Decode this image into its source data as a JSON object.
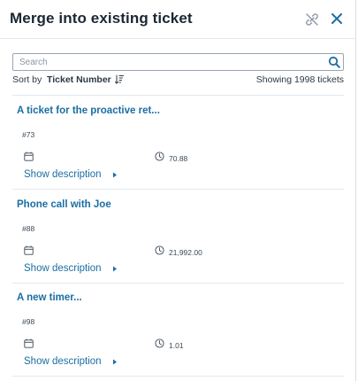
{
  "header": {
    "title": "Merge into existing ticket",
    "unmerge_icon": "link-off-icon",
    "close_icon": "close-icon"
  },
  "search": {
    "placeholder": "Search",
    "value": "",
    "icon": "search-icon"
  },
  "sort": {
    "label": "Sort by",
    "field": "Ticket Number",
    "direction_icon": "sort-descending-icon",
    "count_text": "Showing 1998 tickets"
  },
  "tickets": [
    {
      "title": "A ticket for the proactive ret...",
      "number": "#73",
      "time": "70.88",
      "show_description": "Show description"
    },
    {
      "title": "Phone call with Joe",
      "number": "#88",
      "time": "21,992.00",
      "show_description": "Show description"
    },
    {
      "title": "A new timer...",
      "number": "#98",
      "time": "1.01",
      "show_description": "Show description"
    }
  ],
  "colors": {
    "accent": "#1a6ea3",
    "title_text": "#1b2733",
    "divider": "#e3e7ec"
  }
}
